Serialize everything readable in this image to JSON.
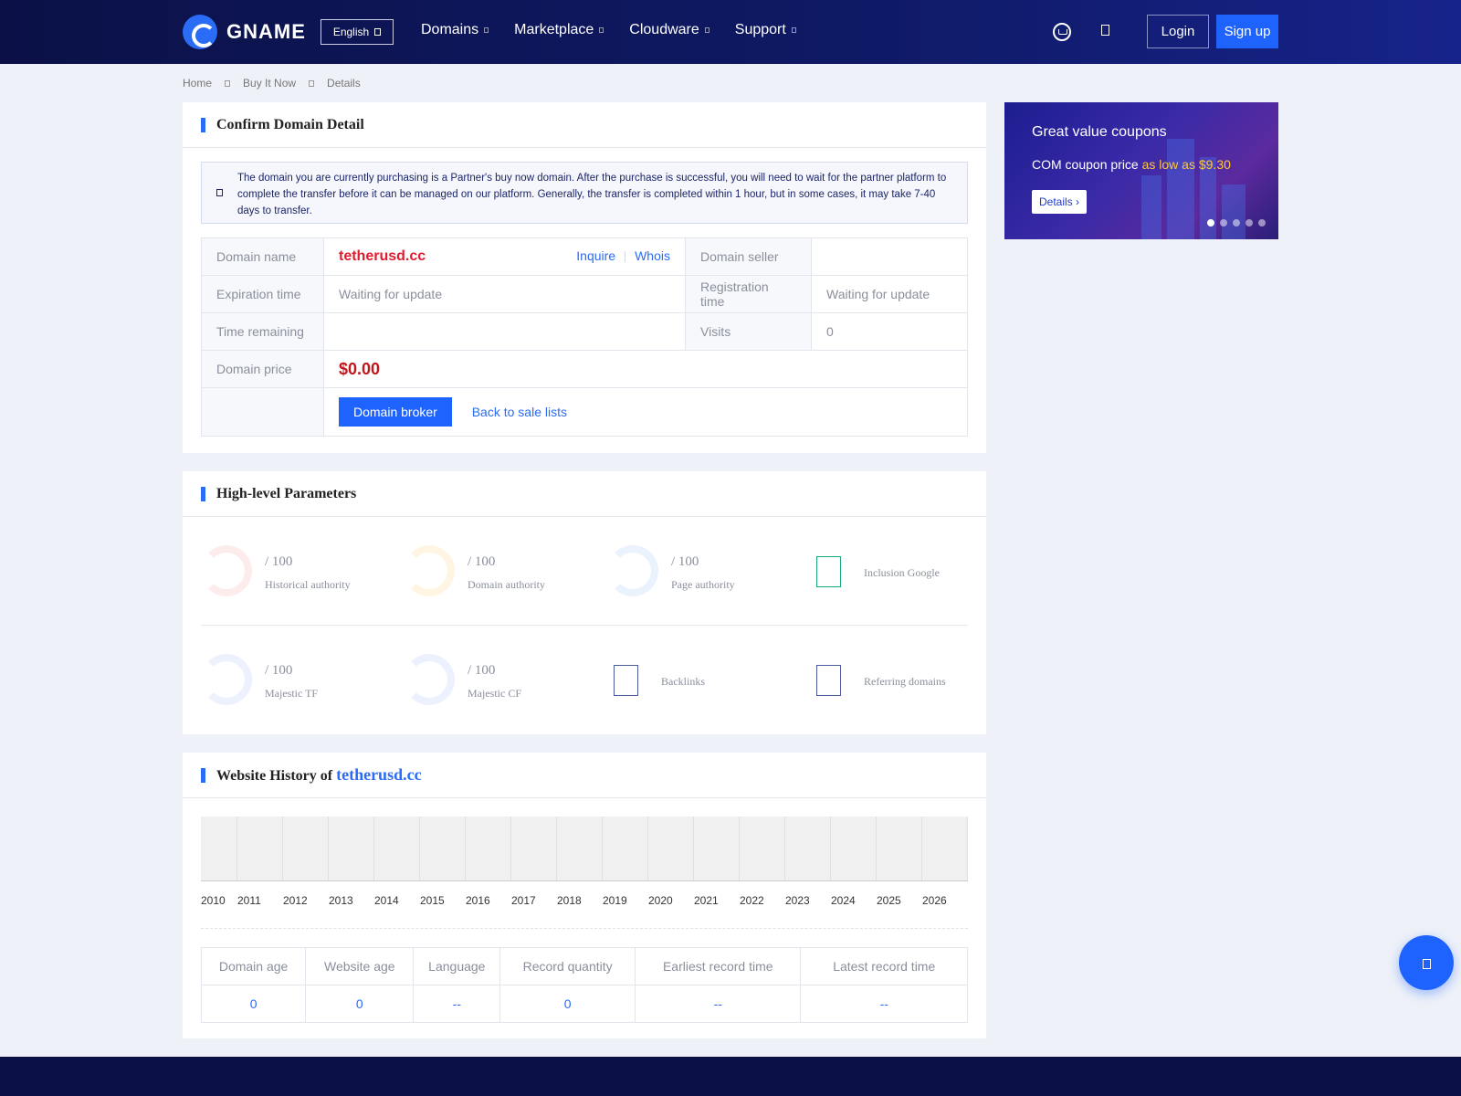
{
  "header": {
    "logo_text": "GNAME",
    "language": "English",
    "nav": [
      {
        "label": "Domains"
      },
      {
        "label": "Marketplace"
      },
      {
        "label": "Cloudware"
      },
      {
        "label": "Support"
      }
    ],
    "login": "Login",
    "signup": "Sign up"
  },
  "breadcrumb": [
    "Home",
    "Buy It Now",
    "Details"
  ],
  "confirm": {
    "title": "Confirm Domain Detail",
    "notice": "The domain you are currently purchasing is a Partner's buy now domain. After the purchase is successful, you will need to wait for the partner platform to complete the transfer before it can be managed on our platform. Generally, the transfer is completed within 1 hour, but in some cases, it may take 7-40 days to transfer.",
    "domain_name_label": "Domain name",
    "domain_name": "tetherusd.cc",
    "inquire": "Inquire",
    "whois": "Whois",
    "domain_seller_label": "Domain seller",
    "domain_seller": "",
    "expiration_label": "Expiration time",
    "expiration": "Waiting for update",
    "registration_label": "Registration time",
    "registration": "Waiting for update",
    "time_remaining_label": "Time remaining",
    "time_remaining": "",
    "visits_label": "Visits",
    "visits": "0",
    "price_label": "Domain price",
    "price": "$0.00",
    "broker_button": "Domain broker",
    "back_link": "Back to sale lists"
  },
  "params": {
    "title": "High-level Parameters",
    "historical_authority": {
      "score": "/ 100",
      "label": "Historical authority"
    },
    "domain_authority": {
      "score": "/ 100",
      "label": "Domain authority"
    },
    "page_authority": {
      "score": "/ 100",
      "label": "Page authority"
    },
    "inclusion_google": {
      "label": "Inclusion Google"
    },
    "majestic_tf": {
      "score": "/ 100",
      "label": "Majestic TF"
    },
    "majestic_cf": {
      "score": "/ 100",
      "label": "Majestic CF"
    },
    "backlinks": {
      "label": "Backlinks"
    },
    "referring_domains": {
      "label": "Referring domains"
    }
  },
  "history": {
    "title_prefix": "Website History of ",
    "domain": "tetherusd.cc",
    "years": [
      "2010",
      "2011",
      "2012",
      "2013",
      "2014",
      "2015",
      "2016",
      "2017",
      "2018",
      "2019",
      "2020",
      "2021",
      "2022",
      "2023",
      "2024",
      "2025",
      "2026"
    ],
    "headers": [
      "Domain age",
      "Website age",
      "Language",
      "Record quantity",
      "Earliest record time",
      "Latest record time"
    ],
    "values": [
      "0",
      "0",
      "--",
      "0",
      "--",
      "--"
    ]
  },
  "ad": {
    "title": "Great value coupons",
    "sub_prefix": "COM coupon price ",
    "sub_highlight": "as low as $9.30",
    "button": "Details"
  },
  "colors": {
    "accent": "#2a6cf6",
    "header_bg": "#0b1147",
    "domain_red": "#e01c2e",
    "price_red": "#c0161c",
    "coupon_yellow": "#ffc53d"
  }
}
